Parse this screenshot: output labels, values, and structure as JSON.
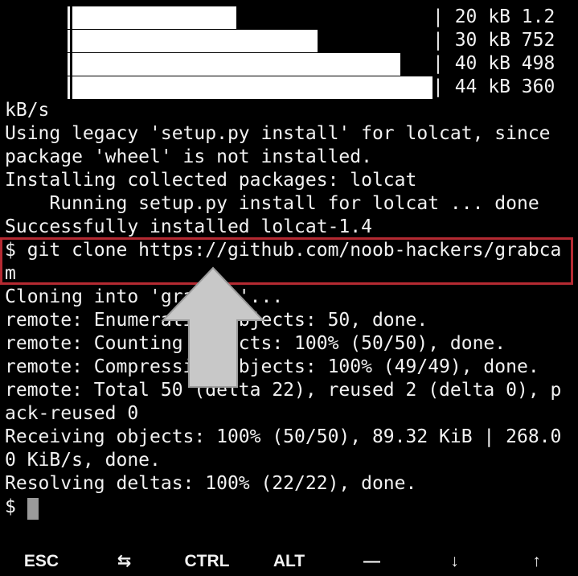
{
  "terminal": {
    "progress_rows": [
      {
        "stats": "| 20 kB 1.2",
        "fraction": 0.455
      },
      {
        "stats": "| 30 kB 752",
        "fraction": 0.68
      },
      {
        "stats": "| 40 kB 498",
        "fraction": 0.91
      },
      {
        "stats": "| 44 kB 360",
        "fraction": 1.0
      }
    ],
    "lines": [
      "kB/s",
      "Using legacy 'setup.py install' for lolcat, since",
      "package 'wheel' is not installed.",
      "Installing collected packages: lolcat",
      "    Running setup.py install for lolcat ... done",
      "Successfully installed lolcat-1.4",
      "$ git clone https://github.com/noob-hackers/grabca",
      "m",
      "Cloning into 'grabcam'...",
      "remote: Enumerating objects: 50, done.",
      "remote: Counting objects: 100% (50/50), done.",
      "remote: Compressing objects: 100% (49/49), done.",
      "remote: Total 50 (delta 22), reused 2 (delta 0), p",
      "ack-reused 0",
      "Receiving objects: 100% (50/50), 89.32 KiB | 268.0",
      "0 KiB/s, done.",
      "Resolving deltas: 100% (22/22), done.",
      "$ "
    ],
    "highlight_color": "#b52a32",
    "arrow_color": "#c8c8c8",
    "cursor_color": "#9a9a9a"
  },
  "extra_keys": [
    {
      "label": "ESC",
      "name": "esc-key"
    },
    {
      "label": "⇆",
      "name": "tab-key"
    },
    {
      "label": "CTRL",
      "name": "ctrl-key"
    },
    {
      "label": "ALT",
      "name": "alt-key"
    },
    {
      "label": "—",
      "name": "dash-key"
    },
    {
      "label": "↓",
      "name": "arrow-down-key"
    },
    {
      "label": "↑",
      "name": "arrow-up-key"
    }
  ]
}
